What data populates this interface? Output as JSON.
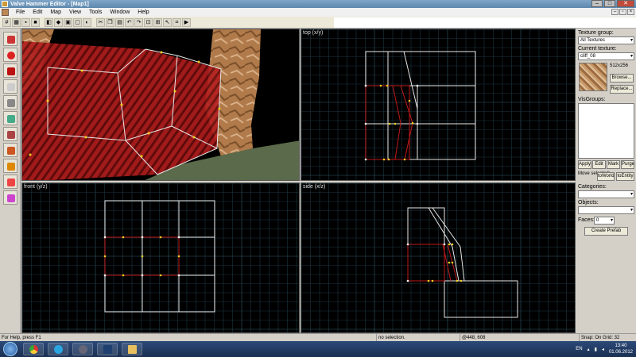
{
  "window": {
    "title": "Valve Hammer Editor - [Map1]"
  },
  "menu": {
    "items": [
      "File",
      "Edit",
      "Map",
      "View",
      "Tools",
      "Window",
      "Help"
    ]
  },
  "viewports": {
    "top_label": "top (x/y)",
    "front_label": "front (y/z)",
    "side_label": "side (x/z)"
  },
  "right_panel": {
    "texture_group_label": "Texture group:",
    "texture_group_value": "All Textures",
    "current_texture_label": "Current texture:",
    "current_texture_value": "cliff_08",
    "texture_size": "512x256",
    "browse_label": "Browse...",
    "replace_label": "Replace...",
    "visgroups_label": "VisGroups:",
    "apply_label": "Apply",
    "edit_label": "Edit",
    "mark_label": "Mark",
    "purge_label": "Purge",
    "move_selected_label": "Move selected:",
    "to_world_label": "toWorld",
    "to_entity_label": "toEntity",
    "categories_label": "Categories:",
    "objects_label": "Objects:",
    "faces_label": "Faces:",
    "faces_value": "0",
    "create_prefab_label": "Create Prefab"
  },
  "status": {
    "help": "For Help, press F1",
    "selection": "no selection.",
    "coords": "@448, 608",
    "snap": "Snap: On Grid: 32"
  },
  "taskbar": {
    "language": "EN",
    "time": "13:40",
    "date": "01.06.2012"
  },
  "colors": {
    "grid_minor": "#1c3540",
    "grid_major": "#2f5c6a",
    "brush_white": "#e8e8e8",
    "brush_red": "#c01818",
    "vertex_yellow": "#f0d020",
    "face_red_3d": "#b41e1e"
  }
}
